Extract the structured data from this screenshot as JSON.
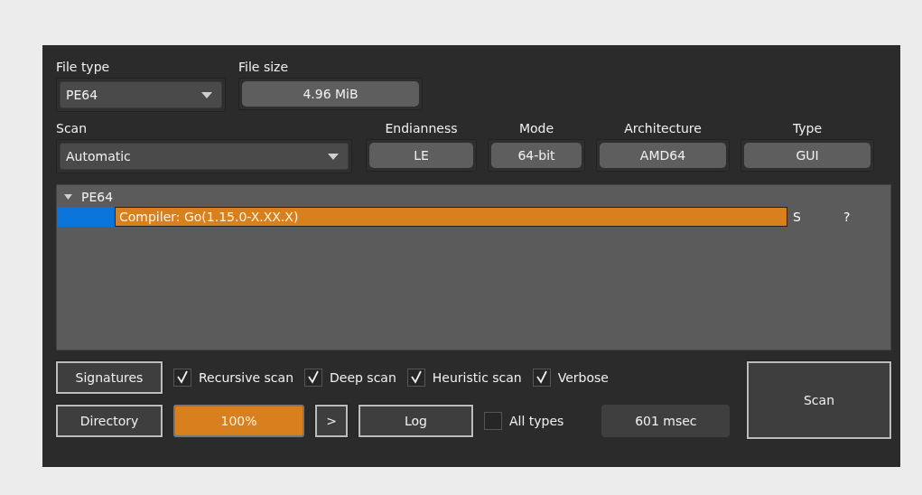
{
  "file_type": {
    "label": "File type",
    "value": "PE64"
  },
  "file_size": {
    "label": "File size",
    "value": "4.96 MiB"
  },
  "scan": {
    "label": "Scan",
    "value": "Automatic"
  },
  "info": [
    {
      "label": "Endianness",
      "value": "LE"
    },
    {
      "label": "Mode",
      "value": "64-bit"
    },
    {
      "label": "Architecture",
      "value": "AMD64"
    },
    {
      "label": "Type",
      "value": "GUI"
    }
  ],
  "tree": {
    "label": "PE64",
    "expanded": true,
    "children": [
      {
        "text": "Compiler: Go(1.15.0-X.XX.X)",
        "column_2": "S",
        "column_3": "?"
      }
    ]
  },
  "signatures_button": "Signatures",
  "options": [
    {
      "label": "Recursive scan",
      "checked": true
    },
    {
      "label": "Deep scan",
      "checked": true
    },
    {
      "label": "Heuristic scan",
      "checked": true
    },
    {
      "label": "Verbose",
      "checked": true
    }
  ],
  "directory_button": "Directory",
  "progress": {
    "level": 1,
    "text": "100%"
  },
  "next_button": ">",
  "log_button": "Log",
  "all_types": {
    "label": "All types",
    "checked": false
  },
  "elapsed": "601 msec",
  "scan_button": "Scan"
}
